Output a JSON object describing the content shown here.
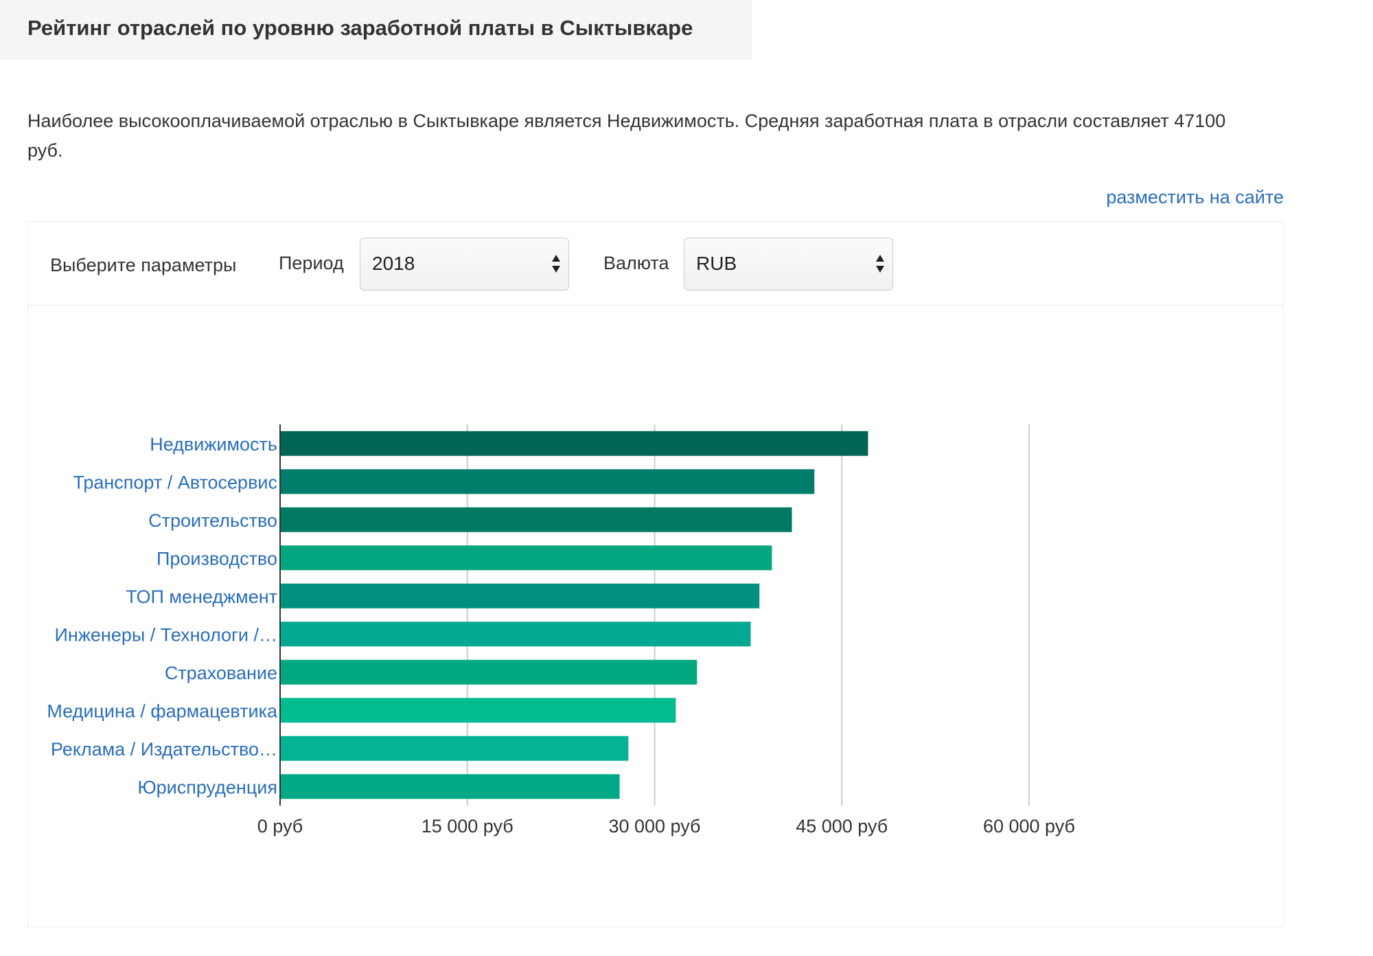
{
  "header": {
    "title": "Рейтинг отраслей по уровню заработной платы в Сыктывкаре"
  },
  "description": "Наиболее высокооплачиваемой отраслью в Сыктывкаре является Недвижимость. Средняя заработная плата в отрасли составляет 47100 руб.",
  "embed_link": "разместить на сайте",
  "params": {
    "label": "Выберите параметры",
    "period_label": "Период",
    "period_value": "2018",
    "currency_label": "Валюта",
    "currency_value": "RUB"
  },
  "chart_data": {
    "type": "bar",
    "orientation": "horizontal",
    "categories": [
      "Недвижимость",
      "Транспорт / Автосервис",
      "Строительство",
      "Производство",
      "ТОП менеджмент",
      "Инженеры / Технологи /…",
      "Страхование",
      "Медицина / фармацевтика",
      "Реклама / Издательство…",
      "Юриспруденция"
    ],
    "values": [
      47100,
      42800,
      41000,
      39400,
      38400,
      37700,
      33400,
      31700,
      27900,
      27200
    ],
    "colors": [
      "#006553",
      "#017d6c",
      "#017a61",
      "#02a77f",
      "#03917f",
      "#03a991",
      "#02a980",
      "#04bc92",
      "#03b392",
      "#03a886"
    ],
    "xlim": [
      0,
      60000
    ],
    "xticks": [
      0,
      15000,
      30000,
      45000,
      60000
    ],
    "xtick_labels": [
      "0 руб",
      "15 000 руб",
      "30 000 руб",
      "45 000 руб",
      "60 000 руб"
    ],
    "grid": true
  }
}
